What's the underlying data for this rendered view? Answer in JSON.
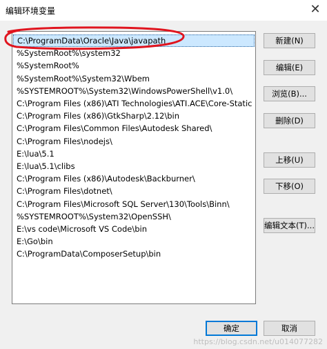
{
  "window": {
    "title": "编辑环境变量",
    "close_glyph": "✕"
  },
  "path_list": {
    "selected_index": 0,
    "items": [
      "C:\\ProgramData\\Oracle\\Java\\javapath",
      "%SystemRoot%\\system32",
      "%SystemRoot%",
      "%SystemRoot%\\System32\\Wbem",
      "%SYSTEMROOT%\\System32\\WindowsPowerShell\\v1.0\\",
      "C:\\Program Files (x86)\\ATI Technologies\\ATI.ACE\\Core-Static",
      "C:\\Program Files (x86)\\GtkSharp\\2.12\\bin",
      "C:\\Program Files\\Common Files\\Autodesk Shared\\",
      "C:\\Program Files\\nodejs\\",
      "E:\\lua\\5.1",
      "E:\\lua\\5.1\\clibs",
      "C:\\Program Files (x86)\\Autodesk\\Backburner\\",
      "C:\\Program Files\\dotnet\\",
      "C:\\Program Files\\Microsoft SQL Server\\130\\Tools\\Binn\\",
      "%SYSTEMROOT%\\System32\\OpenSSH\\",
      "E:\\vs code\\Microsoft VS Code\\bin",
      "E:\\Go\\bin",
      "C:\\ProgramData\\ComposerSetup\\bin"
    ]
  },
  "buttons": {
    "new": "新建(N)",
    "edit": "编辑(E)",
    "browse": "浏览(B)...",
    "delete": "删除(D)",
    "move_up": "上移(U)",
    "move_down": "下移(O)",
    "edit_text": "编辑文本(T)...",
    "ok": "确定",
    "cancel": "取消"
  },
  "watermark": "https://blog.csdn.net/u014077282",
  "colors": {
    "selection": "#cce8ff",
    "annotation": "#e0141e",
    "primary_border": "#0078d7"
  }
}
